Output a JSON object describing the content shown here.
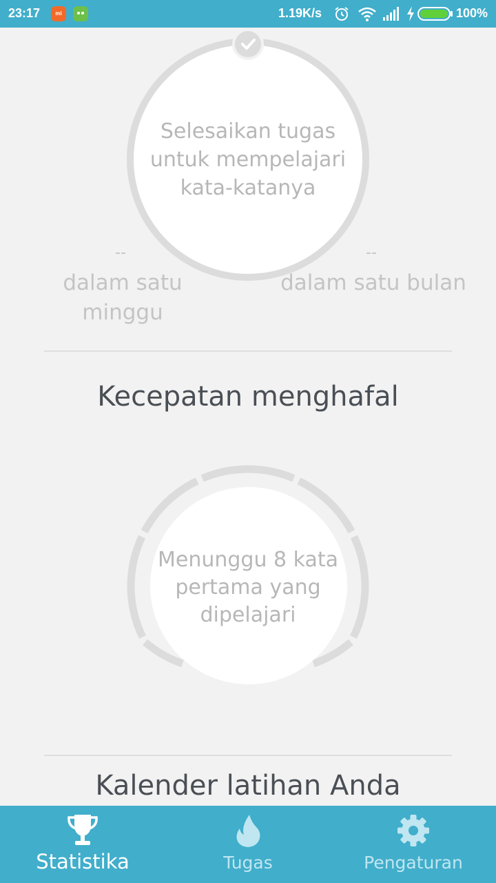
{
  "status_bar": {
    "time": "23:17",
    "app_icon_1_text": "mi",
    "network_speed": "1.19K/s",
    "battery_percent": "100%",
    "icons": [
      "mi-app-icon",
      "android-app-icon",
      "alarm-icon",
      "wifi-icon",
      "signal-icon",
      "charging-icon",
      "battery-icon"
    ]
  },
  "learned_words": {
    "circle_text": "Selesaikan tugas untuk mempelajari kata-katanya",
    "week": {
      "value": "--",
      "label": "dalam satu minggu"
    },
    "month": {
      "value": "--",
      "label": "dalam satu bulan"
    }
  },
  "speed_section": {
    "title": "Kecepatan menghafal",
    "gauge_text": "Menunggu 8 kata pertama yang dipelajari"
  },
  "calendar_section": {
    "title": "Kalender latihan Anda"
  },
  "bottom_nav": {
    "items": [
      {
        "label": "Statistika",
        "icon": "trophy-icon",
        "active": true
      },
      {
        "label": "Tugas",
        "icon": "flame-icon",
        "active": false
      },
      {
        "label": "Pengaturan",
        "icon": "gear-icon",
        "active": false
      }
    ]
  },
  "colors": {
    "accent": "#41aecb",
    "background": "#f2f2f2",
    "ring": "#dcdcdc",
    "title_text": "#4a4f55",
    "muted_text": "#b7b7b7"
  }
}
